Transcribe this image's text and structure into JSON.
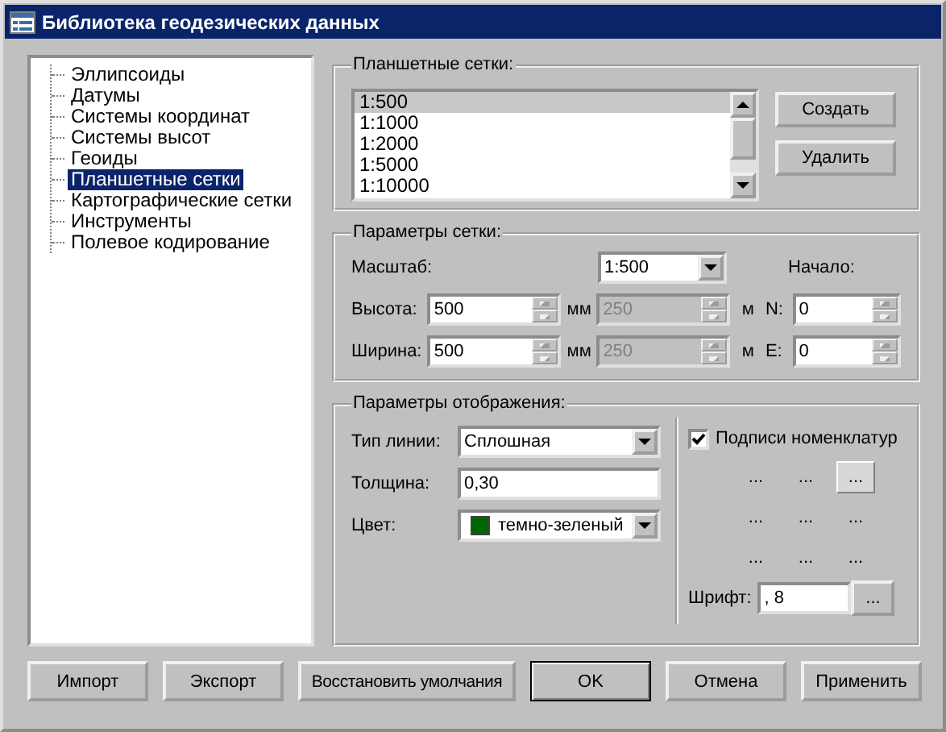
{
  "window": {
    "title": "Библиотека геодезических данных"
  },
  "tree": {
    "items": [
      {
        "label": "Эллипсоиды",
        "selected": false
      },
      {
        "label": "Датумы",
        "selected": false
      },
      {
        "label": "Системы координат",
        "selected": false
      },
      {
        "label": "Системы высот",
        "selected": false
      },
      {
        "label": "Геоиды",
        "selected": false
      },
      {
        "label": "Планшетные сетки",
        "selected": true
      },
      {
        "label": "Картографические сетки",
        "selected": false
      },
      {
        "label": "Инструменты",
        "selected": false
      },
      {
        "label": "Полевое кодирование",
        "selected": false
      }
    ]
  },
  "sheet_grids": {
    "title": "Планшетные сетки:",
    "items": [
      {
        "label": "1:500",
        "selected": true
      },
      {
        "label": "1:1000",
        "selected": false
      },
      {
        "label": "1:2000",
        "selected": false
      },
      {
        "label": "1:5000",
        "selected": false
      },
      {
        "label": "1:10000",
        "selected": false
      }
    ],
    "buttons": [
      "Создать",
      "Удалить"
    ]
  },
  "grid_params": {
    "title": "Параметры сетки:",
    "scale_label": "Масштаб:",
    "scale": "1:500",
    "origin_label": "Начало:",
    "rows": [
      {
        "label": "Высота:",
        "value": "500",
        "unit": "мм",
        "meters": "250",
        "meters_disabled": true,
        "meters_unit": "м",
        "axis": "N:",
        "origin": "0"
      },
      {
        "label": "Ширина:",
        "value": "500",
        "unit": "мм",
        "meters": "250",
        "meters_disabled": true,
        "meters_unit": "м",
        "axis": "E:",
        "origin": "0"
      }
    ]
  },
  "display": {
    "title": "Параметры отображения:",
    "line_type_label": "Тип линии:",
    "line_type": "Сплошная",
    "thickness_label": "Толщина:",
    "thickness": "0,30",
    "color_label": "Цвет:",
    "color_name": "темно-зеленый",
    "color": "#006400",
    "labels_checkbox": {
      "label": "Подписи номенклатур",
      "checked": true
    },
    "positions": [
      {
        "label": "...",
        "selected": false
      },
      {
        "label": "...",
        "selected": false
      },
      {
        "label": "...",
        "selected": true
      },
      {
        "label": "...",
        "selected": false
      },
      {
        "label": "...",
        "selected": false
      },
      {
        "label": "...",
        "selected": false
      },
      {
        "label": "...",
        "selected": false
      },
      {
        "label": "...",
        "selected": false
      },
      {
        "label": "...",
        "selected": false
      }
    ],
    "font_label": "Шрифт:",
    "font": ", 8",
    "font_button": "..."
  },
  "buttons": [
    {
      "label": "Импорт",
      "default": false
    },
    {
      "label": "Экспорт",
      "default": false
    },
    {
      "label": "Восстановить умолчания",
      "default": false
    },
    {
      "label": "OK",
      "default": true
    },
    {
      "label": "Отмена",
      "default": false
    },
    {
      "label": "Применить",
      "default": false
    }
  ]
}
